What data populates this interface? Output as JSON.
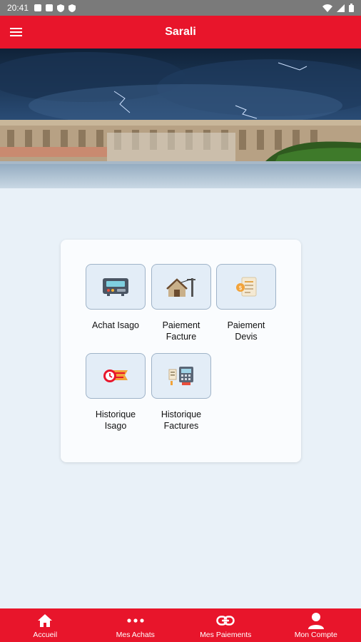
{
  "status_bar": {
    "time": "20:41"
  },
  "app_bar": {
    "title": "Sarali"
  },
  "menu": {
    "tiles": [
      {
        "label_line1": "Achat Isago",
        "label_line2": "",
        "icon": "meter-icon"
      },
      {
        "label_line1": "Paiement",
        "label_line2": "Facture",
        "icon": "house-power-line-icon"
      },
      {
        "label_line1": "Paiement",
        "label_line2": "Devis",
        "icon": "quote-document-icon"
      },
      {
        "label_line1": "Historique",
        "label_line2": "Isago",
        "icon": "clock-history-icon"
      },
      {
        "label_line1": "Historique",
        "label_line2": "Factures",
        "icon": "invoices-history-icon"
      }
    ]
  },
  "bottom_nav": {
    "items": [
      {
        "label": "Accueil",
        "icon": "home-icon"
      },
      {
        "label": "Mes Achats",
        "icon": "more-dots-icon"
      },
      {
        "label": "Mes Paiements",
        "icon": "link-icon"
      },
      {
        "label": "Mon Compte",
        "icon": "person-icon"
      }
    ]
  },
  "colors": {
    "primary": "#e8152b",
    "background": "#e9f1f8",
    "card": "#fafcfe",
    "tile": "#e3edf7"
  }
}
